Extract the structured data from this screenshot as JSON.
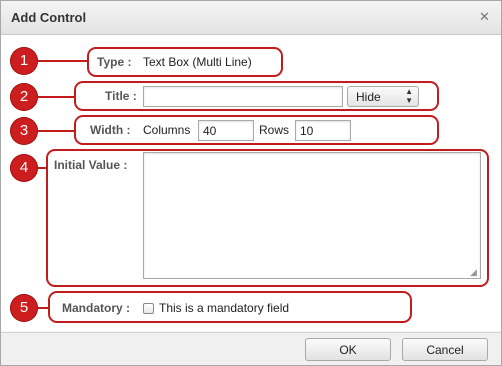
{
  "dialog": {
    "title": "Add Control"
  },
  "markers": [
    "1",
    "2",
    "3",
    "4",
    "5"
  ],
  "type_row": {
    "label": "Type :",
    "value": "Text Box (Multi Line)"
  },
  "title_row": {
    "label": "Title :",
    "value": "",
    "visibility_option": "Hide"
  },
  "width_row": {
    "label": "Width :",
    "columns_label": "Columns",
    "columns_value": "40",
    "rows_label": "Rows",
    "rows_value": "10"
  },
  "initial_value_row": {
    "label": "Initial Value :",
    "value": ""
  },
  "mandatory_row": {
    "label": "Mandatory :",
    "checkbox_label": "This is a mandatory field",
    "checked": false
  },
  "buttons": {
    "ok": "OK",
    "cancel": "Cancel"
  },
  "colors": {
    "accent": "#c21c1c",
    "badge": "#cc1e1e"
  }
}
